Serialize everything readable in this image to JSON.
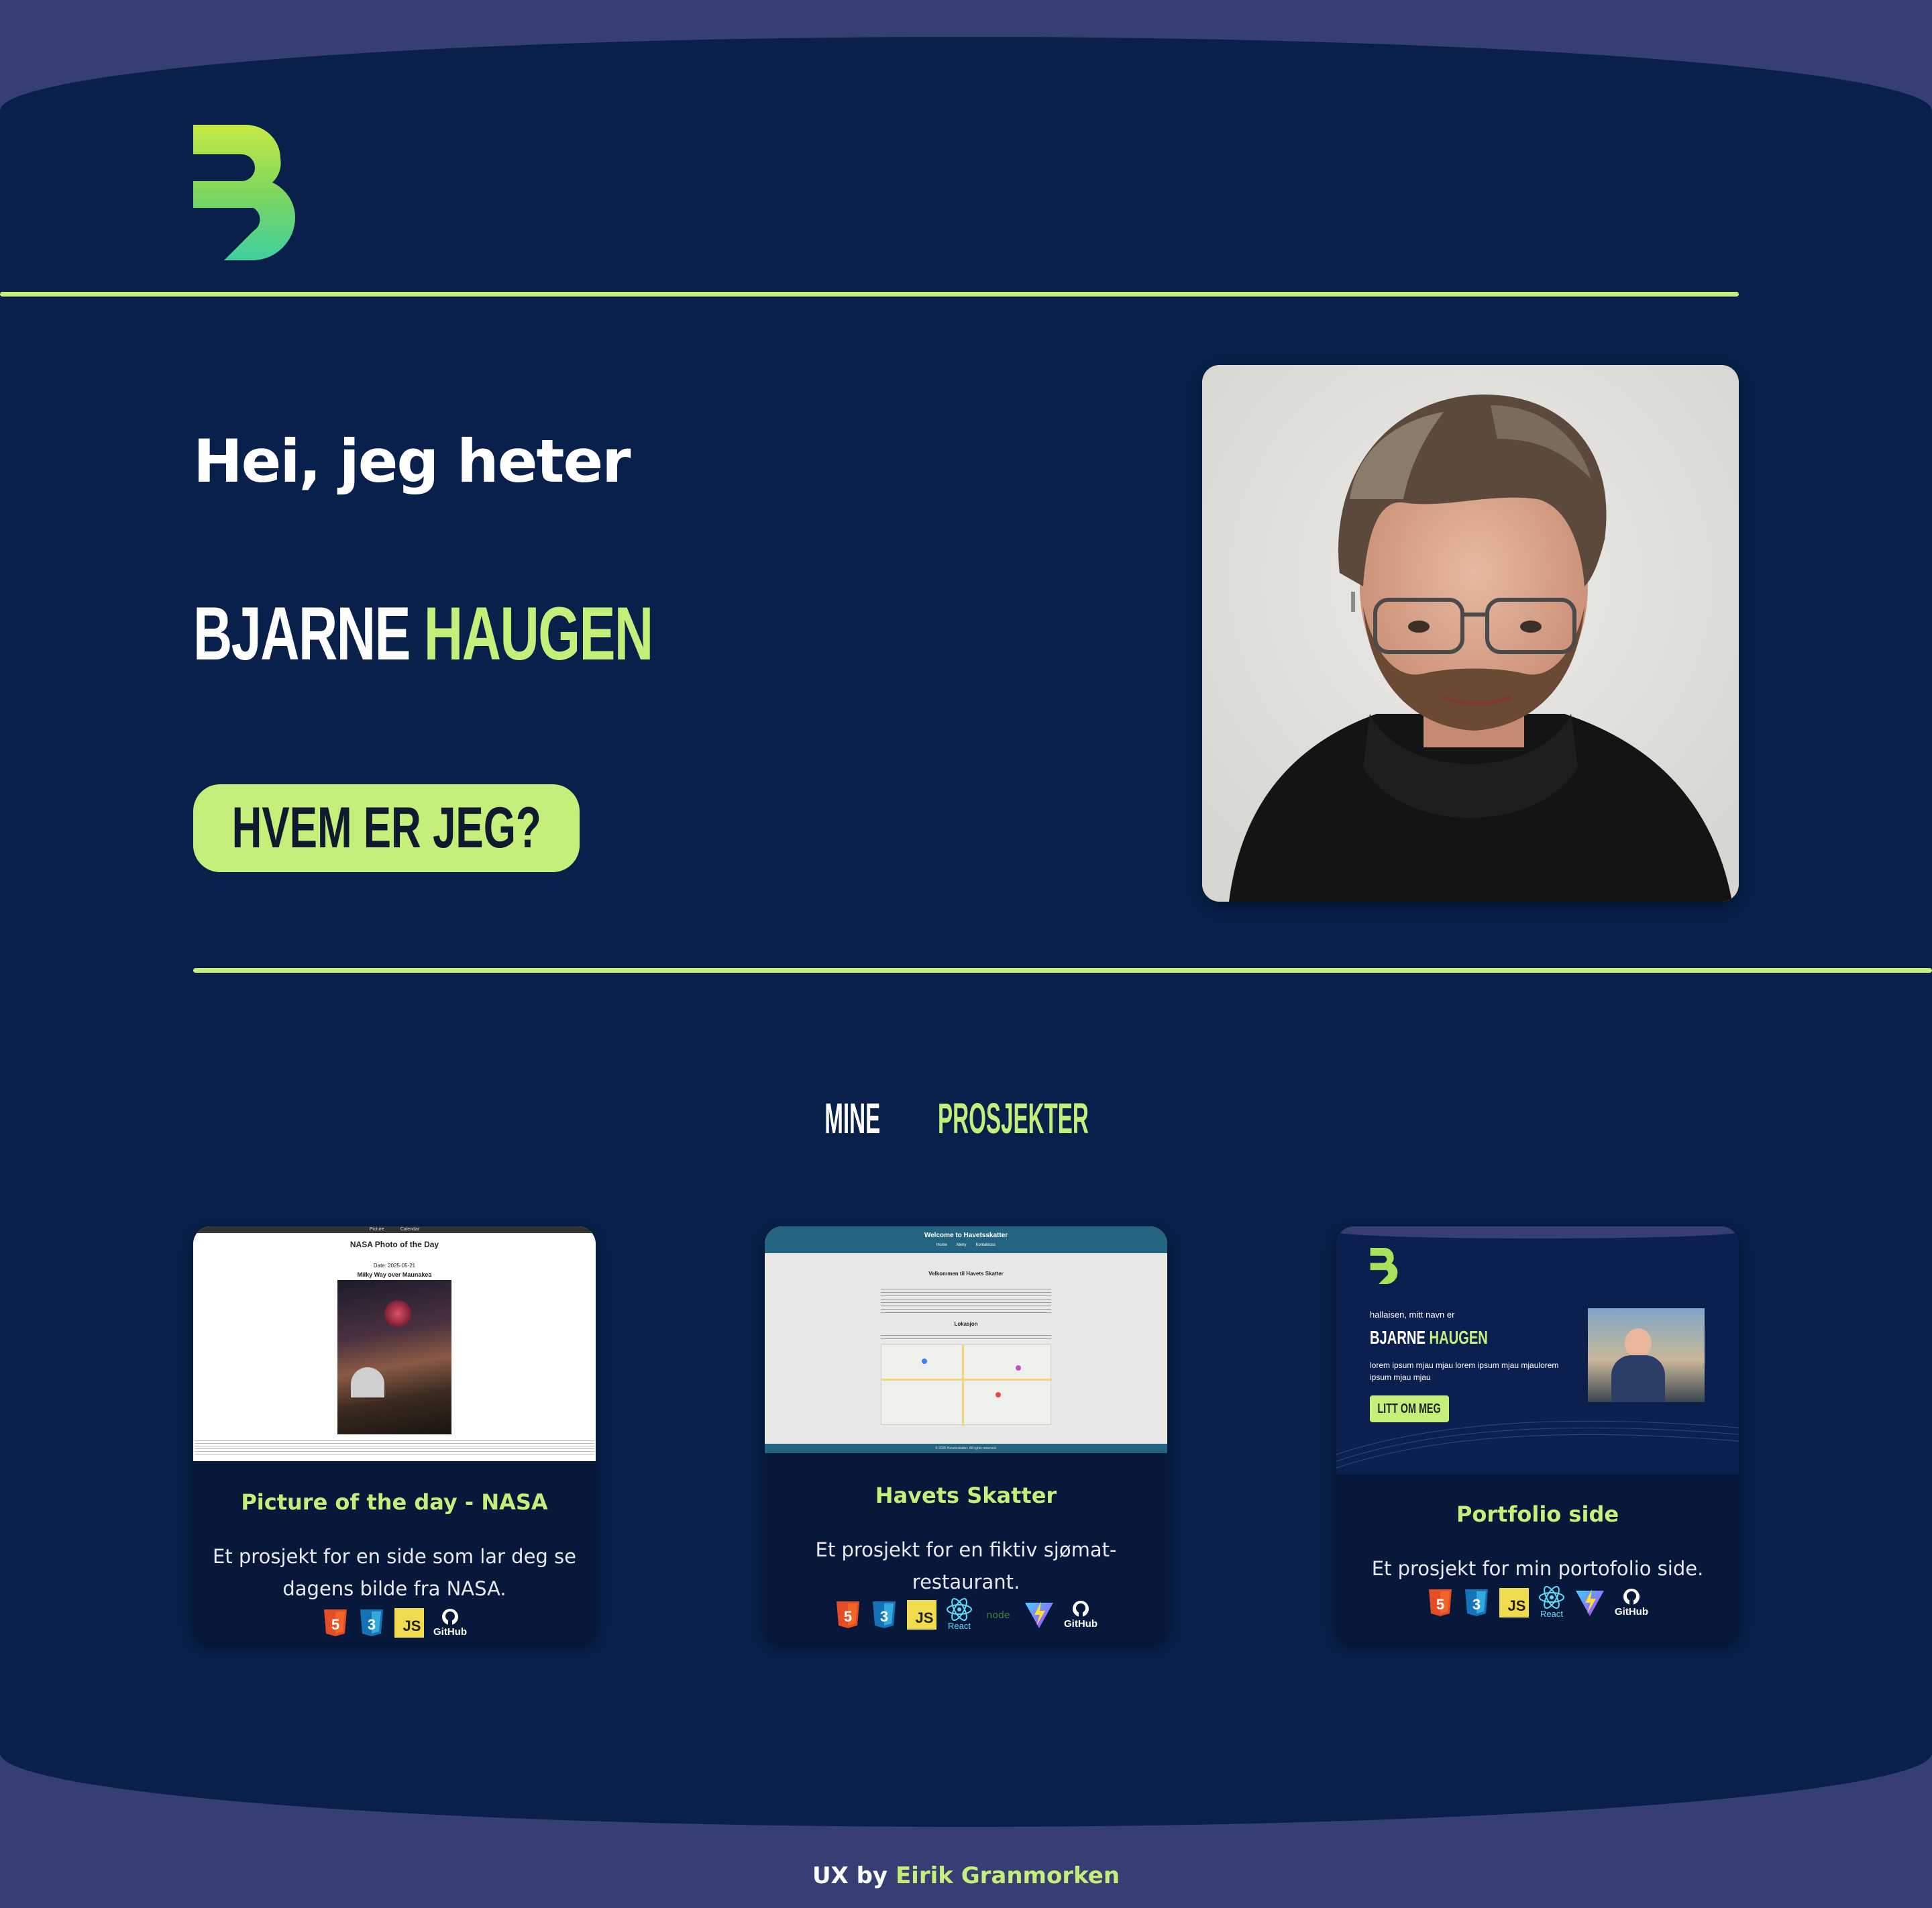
{
  "hero": {
    "greeting": "Hei, jeg heter",
    "first_name": "BJARNE",
    "last_name": "HAUGEN",
    "cta_label": "HVEM ER JEG?"
  },
  "projects": {
    "title_part1": "MINE",
    "title_part2": "PROSJEKTER",
    "items": [
      {
        "title": "Picture of the day - NASA",
        "description": "Et prosjekt for en side som lar deg se dagens bilde fra NASA.",
        "tech": [
          "html5-icon",
          "css3-icon",
          "js-icon",
          "github-icon"
        ],
        "thumb": {
          "nav": [
            "Picture",
            "Calendar"
          ],
          "heading": "NASA Photo of the Day",
          "date": "Date: 2025-05-21",
          "photo_title": "Milky Way over Maunakea"
        }
      },
      {
        "title": "Havets Skatter",
        "description": "Et prosjekt for en fiktiv sjømat-restaurant.",
        "tech": [
          "html5-icon",
          "css3-icon",
          "js-icon",
          "react-icon",
          "node-icon",
          "vite-icon",
          "github-icon"
        ],
        "thumb": {
          "header": "Welcome to Havetsskatter",
          "nav": [
            "Home",
            "Meny",
            "Kontaktoss"
          ],
          "heading": "Velkommen til Havets Skatter",
          "location": "Lokasjon",
          "footer": "© 2025 Havetsskatter. All rights reserved."
        }
      },
      {
        "title": "Portfolio side",
        "description": "Et prosjekt for min portofolio side.",
        "tech": [
          "html5-icon",
          "css3-icon",
          "js-icon",
          "react-icon",
          "vite-icon",
          "github-icon"
        ],
        "thumb": {
          "greeting": "hallaisen, mitt navn er",
          "first_name": "BJARNE",
          "last_name": "HAUGEN",
          "text": "lorem ipsum mjau mjau lorem ipsum mjau mjaulorem ipsum mjau mjau",
          "cta": "LITT OM MEG"
        }
      }
    ]
  },
  "tech_labels": {
    "react": "React",
    "github": "GitHub",
    "js": "JS"
  },
  "footer": {
    "prefix": "UX by",
    "author": "Eirik Granmorken"
  },
  "colors": {
    "background": "#363e74",
    "panel": "#08204a",
    "accent": "#c3ef7a",
    "card": "#07183a"
  }
}
